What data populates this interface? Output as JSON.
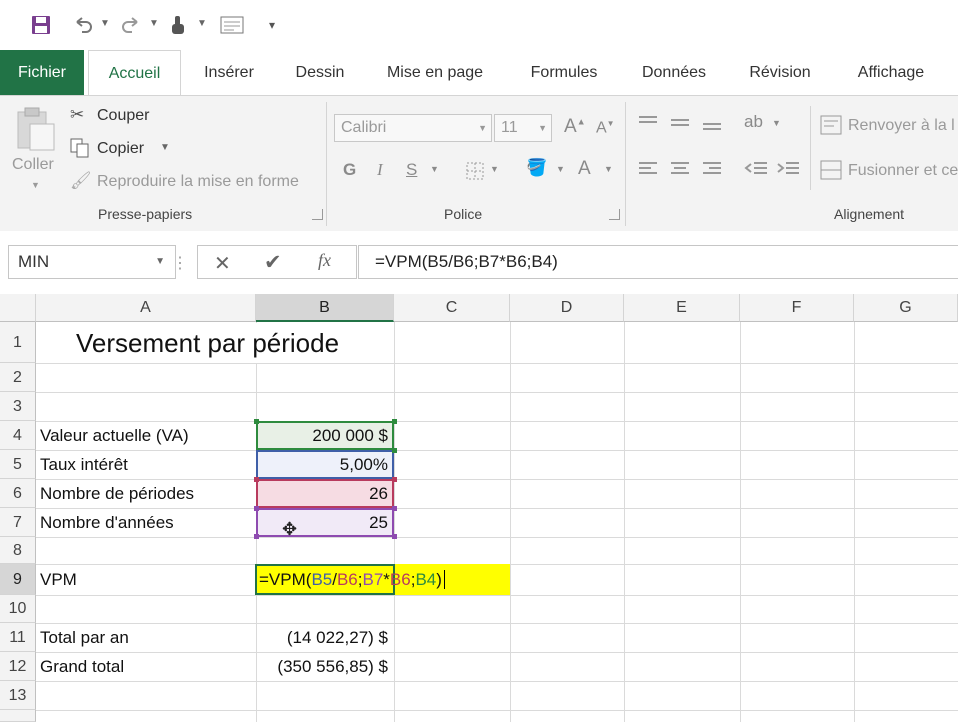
{
  "quick_access": {
    "icons": [
      "save-icon",
      "undo-icon",
      "redo-icon",
      "touch-mode-icon",
      "form-icon",
      "customize-icon"
    ]
  },
  "tabs": [
    {
      "label": "Fichier"
    },
    {
      "label": "Accueil"
    },
    {
      "label": "Insérer"
    },
    {
      "label": "Dessin"
    },
    {
      "label": "Mise en page"
    },
    {
      "label": "Formules"
    },
    {
      "label": "Données"
    },
    {
      "label": "Révision"
    },
    {
      "label": "Affichage"
    }
  ],
  "ribbon": {
    "clipboard": {
      "paste_label": "Coller",
      "cut_label": "Couper",
      "copy_label": "Copier",
      "format_painter_label": "Reproduire la mise en forme",
      "group_label": "Presse-papiers"
    },
    "font": {
      "font_name": "Calibri",
      "font_size": "11",
      "bold": "G",
      "italic": "I",
      "underline": "S",
      "group_label": "Police"
    },
    "alignment": {
      "wrap_text_label": "Renvoyer à la l",
      "merge_label": "Fusionner et ce",
      "group_label": "Alignement"
    }
  },
  "formula_bar": {
    "name_box": "MIN",
    "formula": "=VPM(B5/B6;B7*B6;B4)"
  },
  "columns": [
    "A",
    "B",
    "C",
    "D",
    "E",
    "F",
    "G"
  ],
  "rows": [
    "1",
    "2",
    "3",
    "4",
    "5",
    "6",
    "7",
    "8",
    "9",
    "10",
    "11",
    "12",
    "13"
  ],
  "cells": {
    "A1": "Versement par période",
    "A4": "Valeur actuelle (VA)",
    "B4": "200 000  $",
    "A5": "Taux intérêt",
    "B5": "5,00%",
    "A6": "Nombre de périodes",
    "B6": "26",
    "A7": "Nombre d'années",
    "B7": "25",
    "A9": "VPM",
    "A11": "Total par an",
    "B11": "(14 022,27) $",
    "A12": "Grand total",
    "B12": "(350 556,85) $"
  },
  "edit_formula_parts": {
    "p1": "=VPM(",
    "r1": "B5",
    "p2": "/",
    "r2": "B6",
    "p3": ";",
    "r3": "B7",
    "p4": "*",
    "r4": "B6",
    "p5": ";",
    "r5": "B4",
    "p6": ")"
  },
  "colors": {
    "excel_green": "#217346",
    "ref_b5": "#3f5fa8",
    "ref_b6": "#b83b5e",
    "ref_b7": "#8e4bb0",
    "ref_b4": "#2e8b3e",
    "edit_fill": "#ffff00"
  }
}
